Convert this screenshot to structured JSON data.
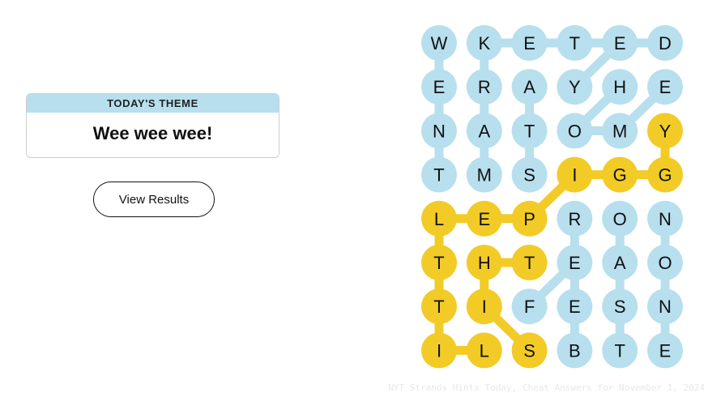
{
  "theme": {
    "header": "TODAY'S THEME",
    "title": "Wee wee wee!"
  },
  "buttons": {
    "view_results": "View Results"
  },
  "colors": {
    "theme_header_bg": "#b7dfee",
    "cell_blue": "#b7dfee",
    "cell_yellow": "#f2cb27",
    "letter": "#111111"
  },
  "grid": {
    "rows": 8,
    "cols": 6,
    "letters": [
      [
        "W",
        "K",
        "E",
        "T",
        "E",
        "D"
      ],
      [
        "E",
        "R",
        "A",
        "Y",
        "H",
        "E"
      ],
      [
        "N",
        "A",
        "T",
        "O",
        "M",
        "Y"
      ],
      [
        "T",
        "M",
        "S",
        "I",
        "G",
        "G"
      ],
      [
        "L",
        "E",
        "P",
        "R",
        "O",
        "N"
      ],
      [
        "T",
        "H",
        "T",
        "E",
        "A",
        "O"
      ],
      [
        "T",
        "I",
        "F",
        "E",
        "S",
        "N"
      ],
      [
        "I",
        "L",
        "S",
        "B",
        "T",
        "E"
      ]
    ],
    "states": [
      [
        "b",
        "b",
        "b",
        "b",
        "b",
        "b"
      ],
      [
        "b",
        "b",
        "b",
        "b",
        "b",
        "b"
      ],
      [
        "b",
        "b",
        "b",
        "b",
        "b",
        "y"
      ],
      [
        "b",
        "b",
        "b",
        "y",
        "y",
        "y"
      ],
      [
        "y",
        "y",
        "y",
        "b",
        "b",
        "b"
      ],
      [
        "y",
        "y",
        "y",
        "b",
        "b",
        "b"
      ],
      [
        "y",
        "y",
        "b",
        "b",
        "b",
        "b"
      ],
      [
        "y",
        "y",
        "y",
        "b",
        "b",
        "b"
      ]
    ],
    "connections": [
      {
        "from": [
          0,
          0
        ],
        "to": [
          1,
          0
        ],
        "color": "b"
      },
      {
        "from": [
          1,
          0
        ],
        "to": [
          2,
          0
        ],
        "color": "b"
      },
      {
        "from": [
          2,
          0
        ],
        "to": [
          3,
          0
        ],
        "color": "b"
      },
      {
        "from": [
          0,
          1
        ],
        "to": [
          0,
          2
        ],
        "color": "b"
      },
      {
        "from": [
          0,
          2
        ],
        "to": [
          0,
          3
        ],
        "color": "b"
      },
      {
        "from": [
          0,
          3
        ],
        "to": [
          0,
          4
        ],
        "color": "b"
      },
      {
        "from": [
          0,
          4
        ],
        "to": [
          0,
          5
        ],
        "color": "b"
      },
      {
        "from": [
          0,
          4
        ],
        "to": [
          1,
          3
        ],
        "color": "b"
      },
      {
        "from": [
          0,
          1
        ],
        "to": [
          1,
          1
        ],
        "color": "b"
      },
      {
        "from": [
          1,
          1
        ],
        "to": [
          2,
          1
        ],
        "color": "b"
      },
      {
        "from": [
          2,
          1
        ],
        "to": [
          3,
          1
        ],
        "color": "b"
      },
      {
        "from": [
          1,
          2
        ],
        "to": [
          2,
          2
        ],
        "color": "b"
      },
      {
        "from": [
          2,
          2
        ],
        "to": [
          3,
          2
        ],
        "color": "b"
      },
      {
        "from": [
          1,
          4
        ],
        "to": [
          2,
          3
        ],
        "color": "b"
      },
      {
        "from": [
          2,
          3
        ],
        "to": [
          2,
          4
        ],
        "color": "b"
      },
      {
        "from": [
          2,
          4
        ],
        "to": [
          1,
          5
        ],
        "color": "b"
      },
      {
        "from": [
          2,
          5
        ],
        "to": [
          3,
          5
        ],
        "color": "y"
      },
      {
        "from": [
          3,
          5
        ],
        "to": [
          3,
          4
        ],
        "color": "y"
      },
      {
        "from": [
          3,
          4
        ],
        "to": [
          3,
          3
        ],
        "color": "y"
      },
      {
        "from": [
          3,
          3
        ],
        "to": [
          4,
          2
        ],
        "color": "y"
      },
      {
        "from": [
          4,
          2
        ],
        "to": [
          4,
          1
        ],
        "color": "y"
      },
      {
        "from": [
          4,
          1
        ],
        "to": [
          4,
          0
        ],
        "color": "y"
      },
      {
        "from": [
          4,
          0
        ],
        "to": [
          5,
          0
        ],
        "color": "y"
      },
      {
        "from": [
          5,
          0
        ],
        "to": [
          6,
          0
        ],
        "color": "y"
      },
      {
        "from": [
          6,
          0
        ],
        "to": [
          7,
          0
        ],
        "color": "y"
      },
      {
        "from": [
          7,
          0
        ],
        "to": [
          7,
          1
        ],
        "color": "y"
      },
      {
        "from": [
          5,
          2
        ],
        "to": [
          5,
          1
        ],
        "color": "y"
      },
      {
        "from": [
          5,
          1
        ],
        "to": [
          6,
          1
        ],
        "color": "y"
      },
      {
        "from": [
          6,
          1
        ],
        "to": [
          7,
          2
        ],
        "color": "y"
      },
      {
        "from": [
          4,
          4
        ],
        "to": [
          5,
          4
        ],
        "color": "b"
      },
      {
        "from": [
          5,
          4
        ],
        "to": [
          6,
          4
        ],
        "color": "b"
      },
      {
        "from": [
          6,
          4
        ],
        "to": [
          7,
          4
        ],
        "color": "b"
      },
      {
        "from": [
          4,
          3
        ],
        "to": [
          5,
          3
        ],
        "color": "b"
      },
      {
        "from": [
          5,
          3
        ],
        "to": [
          6,
          3
        ],
        "color": "b"
      },
      {
        "from": [
          6,
          3
        ],
        "to": [
          7,
          3
        ],
        "color": "b"
      },
      {
        "from": [
          6,
          2
        ],
        "to": [
          5,
          3
        ],
        "color": "b"
      },
      {
        "from": [
          4,
          5
        ],
        "to": [
          5,
          5
        ],
        "color": "b"
      },
      {
        "from": [
          5,
          5
        ],
        "to": [
          6,
          5
        ],
        "color": "b"
      },
      {
        "from": [
          6,
          5
        ],
        "to": [
          7,
          5
        ],
        "color": "b"
      }
    ]
  },
  "watermark": "NYT Strands Hints Today, Cheat Answers for November 1, 2024"
}
